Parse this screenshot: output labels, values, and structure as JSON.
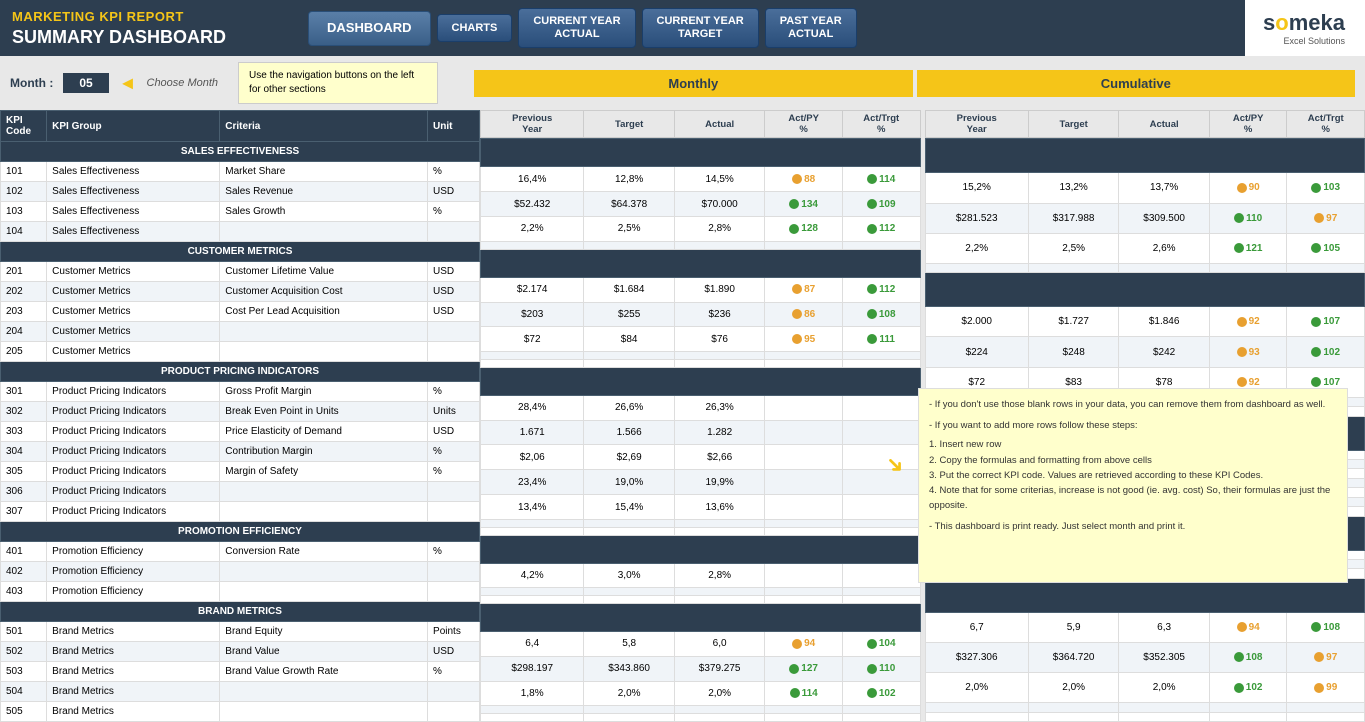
{
  "header": {
    "marketing_label": "MARKETING KPI REPORT",
    "dashboard_label": "SUMMARY DASHBOARD",
    "nav": {
      "dashboard": "DASHBOARD",
      "charts": "CHARTS",
      "current_year_actual_line1": "CURRENT YEAR",
      "current_year_actual_line2": "ACTUAL",
      "current_year_target_line1": "CURRENT YEAR",
      "current_year_target_line2": "TARGET",
      "past_year_line1": "PAST YEAR",
      "past_year_line2": "ACTUAL"
    },
    "logo": {
      "name": "someka",
      "tagline": "Excel Solutions"
    }
  },
  "month_selector": {
    "label": "Month :",
    "value": "05",
    "arrow": "◄",
    "choose": "Choose Month",
    "hint": "Use the navigation buttons on the left for other sections"
  },
  "columns": {
    "kpi_code": "KPI Code",
    "kpi_group": "KPI Group",
    "criteria": "Criteria",
    "unit": "Unit"
  },
  "monthly": {
    "header": "Monthly",
    "cols": [
      "Previous Year",
      "Target",
      "Actual",
      "Act/PY %",
      "Act/Trgt %"
    ]
  },
  "cumulative": {
    "header": "Cumulative",
    "cols": [
      "Previous Year",
      "Target",
      "Actual",
      "Act/PY %",
      "Act/Trgt %"
    ]
  },
  "sections": [
    {
      "name": "SALES EFFECTIVENESS",
      "rows": [
        {
          "code": "101",
          "group": "Sales Effectiveness",
          "criteria": "Market Share",
          "unit": "%",
          "m_prev": "16,4%",
          "m_tgt": "12,8%",
          "m_act": "14,5%",
          "m_actpy": "88",
          "m_actpy_color": "orange",
          "m_acttgt": "114",
          "m_acttgt_color": "green",
          "c_prev": "15,2%",
          "c_tgt": "13,2%",
          "c_act": "13,7%",
          "c_actpy": "90",
          "c_actpy_color": "orange",
          "c_acttgt": "103",
          "c_acttgt_color": "green"
        },
        {
          "code": "102",
          "group": "Sales Effectiveness",
          "criteria": "Sales Revenue",
          "unit": "USD",
          "m_prev": "$52.432",
          "m_tgt": "$64.378",
          "m_act": "$70.000",
          "m_actpy": "134",
          "m_actpy_color": "green",
          "m_acttgt": "109",
          "m_acttgt_color": "green",
          "c_prev": "$281.523",
          "c_tgt": "$317.988",
          "c_act": "$309.500",
          "c_actpy": "110",
          "c_actpy_color": "green",
          "c_acttgt": "97",
          "c_acttgt_color": "orange"
        },
        {
          "code": "103",
          "group": "Sales Effectiveness",
          "criteria": "Sales Growth",
          "unit": "%",
          "m_prev": "2,2%",
          "m_tgt": "2,5%",
          "m_act": "2,8%",
          "m_actpy": "128",
          "m_actpy_color": "green",
          "m_acttgt": "112",
          "m_acttgt_color": "green",
          "c_prev": "2,2%",
          "c_tgt": "2,5%",
          "c_act": "2,6%",
          "c_actpy": "121",
          "c_actpy_color": "green",
          "c_acttgt": "105",
          "c_acttgt_color": "green"
        },
        {
          "code": "104",
          "group": "Sales Effectiveness",
          "criteria": "",
          "unit": "",
          "m_prev": "",
          "m_tgt": "",
          "m_act": "",
          "m_actpy": "",
          "m_actpy_color": "",
          "m_acttgt": "",
          "m_acttgt_color": "",
          "c_prev": "",
          "c_tgt": "",
          "c_act": "",
          "c_actpy": "",
          "c_actpy_color": "",
          "c_acttgt": "",
          "c_acttgt_color": ""
        }
      ]
    },
    {
      "name": "CUSTOMER METRICS",
      "rows": [
        {
          "code": "201",
          "group": "Customer Metrics",
          "criteria": "Customer Lifetime Value",
          "unit": "USD",
          "m_prev": "$2.174",
          "m_tgt": "$1.684",
          "m_act": "$1.890",
          "m_actpy": "87",
          "m_actpy_color": "orange",
          "m_acttgt": "112",
          "m_acttgt_color": "green",
          "c_prev": "$2.000",
          "c_tgt": "$1.727",
          "c_act": "$1.846",
          "c_actpy": "92",
          "c_actpy_color": "orange",
          "c_acttgt": "107",
          "c_acttgt_color": "green"
        },
        {
          "code": "202",
          "group": "Customer Metrics",
          "criteria": "Customer Acquisition Cost",
          "unit": "USD",
          "m_prev": "$203",
          "m_tgt": "$255",
          "m_act": "$236",
          "m_actpy": "86",
          "m_actpy_color": "orange",
          "m_acttgt": "108",
          "m_acttgt_color": "green",
          "c_prev": "$224",
          "c_tgt": "$248",
          "c_act": "$242",
          "c_actpy": "93",
          "c_actpy_color": "orange",
          "c_acttgt": "102",
          "c_acttgt_color": "green"
        },
        {
          "code": "203",
          "group": "Customer Metrics",
          "criteria": "Cost Per Lead Acquisition",
          "unit": "USD",
          "m_prev": "$72",
          "m_tgt": "$84",
          "m_act": "$76",
          "m_actpy": "95",
          "m_actpy_color": "orange",
          "m_acttgt": "111",
          "m_acttgt_color": "green",
          "c_prev": "$72",
          "c_tgt": "$83",
          "c_act": "$78",
          "c_actpy": "92",
          "c_actpy_color": "orange",
          "c_acttgt": "107",
          "c_acttgt_color": "green"
        },
        {
          "code": "204",
          "group": "Customer Metrics",
          "criteria": "",
          "unit": "",
          "m_prev": "",
          "m_tgt": "",
          "m_act": "",
          "m_actpy": "",
          "m_actpy_color": "",
          "m_acttgt": "",
          "m_acttgt_color": "",
          "c_prev": "",
          "c_tgt": "",
          "c_act": "",
          "c_actpy": "",
          "c_actpy_color": "",
          "c_acttgt": "",
          "c_acttgt_color": ""
        },
        {
          "code": "205",
          "group": "Customer Metrics",
          "criteria": "",
          "unit": "",
          "m_prev": "",
          "m_tgt": "",
          "m_act": "",
          "m_actpy": "",
          "m_actpy_color": "",
          "m_acttgt": "",
          "m_acttgt_color": "",
          "c_prev": "",
          "c_tgt": "",
          "c_act": "",
          "c_actpy": "",
          "c_actpy_color": "",
          "c_acttgt": "",
          "c_acttgt_color": ""
        }
      ]
    },
    {
      "name": "PRODUCT PRICING INDICATORS",
      "rows": [
        {
          "code": "301",
          "group": "Product Pricing Indicators",
          "criteria": "Gross Profit Margin",
          "unit": "%",
          "m_prev": "28,4%",
          "m_tgt": "26,6%",
          "m_act": "26,3%",
          "m_actpy": "",
          "m_actpy_color": "",
          "m_acttgt": "",
          "m_acttgt_color": "",
          "c_prev": "",
          "c_tgt": "",
          "c_act": "",
          "c_actpy": "",
          "c_actpy_color": "",
          "c_acttgt": "",
          "c_acttgt_color": "",
          "show_hint": true
        },
        {
          "code": "302",
          "group": "Product Pricing Indicators",
          "criteria": "Break Even Point in Units",
          "unit": "Units",
          "m_prev": "1.671",
          "m_tgt": "1.566",
          "m_act": "1.282",
          "m_actpy": "",
          "m_actpy_color": "",
          "m_acttgt": "",
          "m_acttgt_color": "",
          "c_prev": "",
          "c_tgt": "",
          "c_act": "",
          "c_actpy": "",
          "c_actpy_color": "",
          "c_acttgt": "",
          "c_acttgt_color": ""
        },
        {
          "code": "303",
          "group": "Product Pricing Indicators",
          "criteria": "Price Elasticity of Demand",
          "unit": "USD",
          "m_prev": "$2,06",
          "m_tgt": "$2,69",
          "m_act": "$2,66",
          "m_actpy": "",
          "m_actpy_color": "",
          "m_acttgt": "",
          "m_acttgt_color": "",
          "c_prev": "",
          "c_tgt": "",
          "c_act": "",
          "c_actpy": "",
          "c_actpy_color": "",
          "c_acttgt": "",
          "c_acttgt_color": ""
        },
        {
          "code": "304",
          "group": "Product Pricing Indicators",
          "criteria": "Contribution Margin",
          "unit": "%",
          "m_prev": "23,4%",
          "m_tgt": "19,0%",
          "m_act": "19,9%",
          "m_actpy": "",
          "m_actpy_color": "",
          "m_acttgt": "",
          "m_acttgt_color": "",
          "c_prev": "",
          "c_tgt": "",
          "c_act": "",
          "c_actpy": "",
          "c_actpy_color": "",
          "c_acttgt": "",
          "c_acttgt_color": ""
        },
        {
          "code": "305",
          "group": "Product Pricing Indicators",
          "criteria": "Margin of Safety",
          "unit": "%",
          "m_prev": "13,4%",
          "m_tgt": "15,4%",
          "m_act": "13,6%",
          "m_actpy": "",
          "m_actpy_color": "",
          "m_acttgt": "",
          "m_acttgt_color": "",
          "c_prev": "",
          "c_tgt": "",
          "c_act": "",
          "c_actpy": "",
          "c_actpy_color": "",
          "c_acttgt": "",
          "c_acttgt_color": ""
        },
        {
          "code": "306",
          "group": "Product Pricing Indicators",
          "criteria": "",
          "unit": "",
          "m_prev": "",
          "m_tgt": "",
          "m_act": "",
          "m_actpy": "",
          "m_actpy_color": "",
          "m_acttgt": "",
          "m_acttgt_color": "",
          "c_prev": "",
          "c_tgt": "",
          "c_act": "",
          "c_actpy": "",
          "c_actpy_color": "",
          "c_acttgt": "",
          "c_acttgt_color": ""
        },
        {
          "code": "307",
          "group": "Product Pricing Indicators",
          "criteria": "",
          "unit": "",
          "m_prev": "",
          "m_tgt": "",
          "m_act": "",
          "m_actpy": "",
          "m_actpy_color": "",
          "m_acttgt": "",
          "m_acttgt_color": "",
          "c_prev": "",
          "c_tgt": "",
          "c_act": "",
          "c_actpy": "",
          "c_actpy_color": "",
          "c_acttgt": "",
          "c_acttgt_color": ""
        }
      ]
    },
    {
      "name": "PROMOTION EFFICIENCY",
      "rows": [
        {
          "code": "401",
          "group": "Promotion Efficiency",
          "criteria": "Conversion Rate",
          "unit": "%",
          "m_prev": "4,2%",
          "m_tgt": "3,0%",
          "m_act": "2,8%",
          "m_actpy": "",
          "m_actpy_color": "",
          "m_acttgt": "",
          "m_acttgt_color": "",
          "c_prev": "",
          "c_tgt": "",
          "c_act": "",
          "c_actpy": "",
          "c_actpy_color": "",
          "c_acttgt": "",
          "c_acttgt_color": ""
        },
        {
          "code": "402",
          "group": "Promotion Efficiency",
          "criteria": "",
          "unit": "",
          "m_prev": "",
          "m_tgt": "",
          "m_act": "",
          "m_actpy": "",
          "m_actpy_color": "",
          "m_acttgt": "",
          "m_acttgt_color": "",
          "c_prev": "",
          "c_tgt": "",
          "c_act": "",
          "c_actpy": "",
          "c_actpy_color": "",
          "c_acttgt": "",
          "c_acttgt_color": ""
        },
        {
          "code": "403",
          "group": "Promotion Efficiency",
          "criteria": "",
          "unit": "",
          "m_prev": "",
          "m_tgt": "",
          "m_act": "",
          "m_actpy": "",
          "m_actpy_color": "",
          "m_acttgt": "",
          "m_acttgt_color": "",
          "c_prev": "",
          "c_tgt": "",
          "c_act": "",
          "c_actpy": "",
          "c_actpy_color": "",
          "c_acttgt": "",
          "c_acttgt_color": ""
        }
      ]
    },
    {
      "name": "BRAND METRICS",
      "rows": [
        {
          "code": "501",
          "group": "Brand Metrics",
          "criteria": "Brand Equity",
          "unit": "Points",
          "m_prev": "6,4",
          "m_tgt": "5,8",
          "m_act": "6,0",
          "m_actpy": "94",
          "m_actpy_color": "orange",
          "m_acttgt": "104",
          "m_acttgt_color": "green",
          "c_prev": "6,7",
          "c_tgt": "5,9",
          "c_act": "6,3",
          "c_actpy": "94",
          "c_actpy_color": "orange",
          "c_acttgt": "108",
          "c_acttgt_color": "green"
        },
        {
          "code": "502",
          "group": "Brand Metrics",
          "criteria": "Brand Value",
          "unit": "USD",
          "m_prev": "$298.197",
          "m_tgt": "$343.860",
          "m_act": "$379.275",
          "m_actpy": "127",
          "m_actpy_color": "green",
          "m_acttgt": "110",
          "m_acttgt_color": "green",
          "c_prev": "$327.306",
          "c_tgt": "$364.720",
          "c_act": "$352.305",
          "c_actpy": "108",
          "c_actpy_color": "green",
          "c_acttgt": "97",
          "c_acttgt_color": "orange"
        },
        {
          "code": "503",
          "group": "Brand Metrics",
          "criteria": "Brand Value Growth Rate",
          "unit": "%",
          "m_prev": "1,8%",
          "m_tgt": "2,0%",
          "m_act": "2,0%",
          "m_actpy": "114",
          "m_actpy_color": "green",
          "m_acttgt": "102",
          "m_acttgt_color": "green",
          "c_prev": "2,0%",
          "c_tgt": "2,0%",
          "c_act": "2,0%",
          "c_actpy": "102",
          "c_actpy_color": "green",
          "c_acttgt": "99",
          "c_acttgt_color": "orange"
        },
        {
          "code": "504",
          "group": "Brand Metrics",
          "criteria": "",
          "unit": "",
          "m_prev": "",
          "m_tgt": "",
          "m_act": "",
          "m_actpy": "",
          "m_actpy_color": "",
          "m_acttgt": "",
          "m_acttgt_color": "",
          "c_prev": "",
          "c_tgt": "",
          "c_act": "",
          "c_actpy": "",
          "c_actpy_color": "",
          "c_acttgt": "",
          "c_acttgt_color": ""
        },
        {
          "code": "505",
          "group": "Brand Metrics",
          "criteria": "",
          "unit": "",
          "m_prev": "",
          "m_tgt": "",
          "m_act": "",
          "m_actpy": "",
          "m_actpy_color": "",
          "m_acttgt": "",
          "m_acttgt_color": "",
          "c_prev": "",
          "c_tgt": "",
          "c_act": "",
          "c_actpy": "",
          "c_actpy_color": "",
          "c_acttgt": "",
          "c_acttgt_color": ""
        }
      ]
    }
  ],
  "hint_text": {
    "line1": "- If you don't use those blank rows in your data, you can remove them from dashboard as well.",
    "line2": "- If you want to add more rows follow these steps:",
    "line3": "1. Insert new row",
    "line4": "2. Copy the formulas and formatting from above cells",
    "line5": "3. Put the correct KPI code. Values are retrieved according to these KPI Codes.",
    "line6": "4. Note that for some criterias, increase is not good (ie. avg. cost) So, their formulas are just the opposite.",
    "line7": "- This dashboard is print ready. Just select month and print it."
  }
}
